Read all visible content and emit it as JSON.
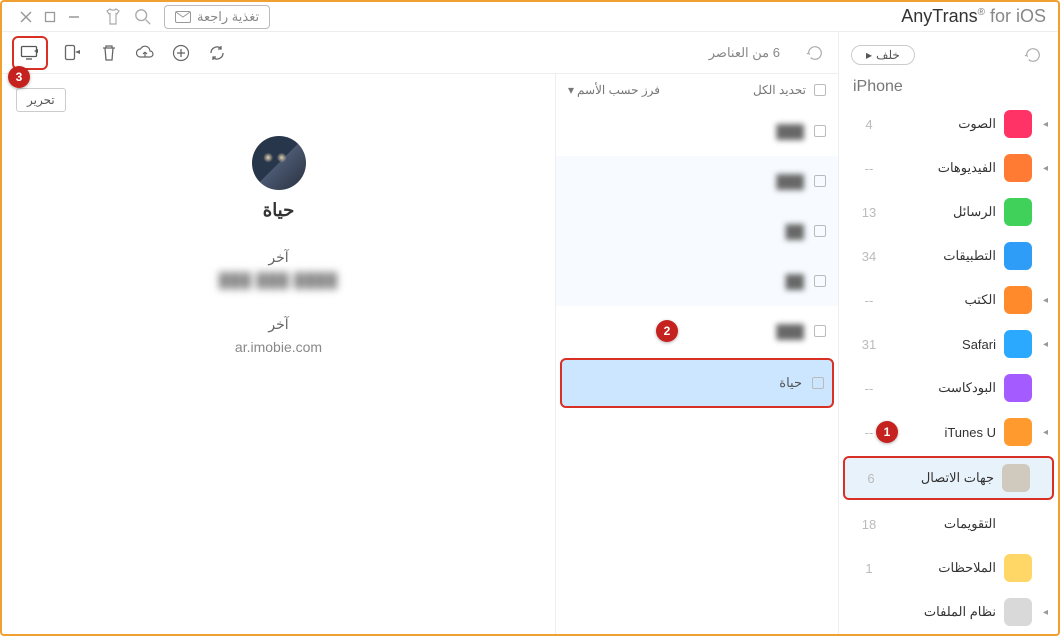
{
  "brand": {
    "name": "AnyTrans",
    "suffix": "for iOS"
  },
  "titlebar": {
    "feedback": "تغذية راجعة"
  },
  "toolbar": {
    "items_count": "6 من العناصر",
    "sort_label": "فرز حسب الأسم",
    "select_all": "تحديد الكل"
  },
  "sidebar": {
    "back": "خلف",
    "device": "iPhone",
    "items": [
      {
        "label": "الصوت",
        "count": "4",
        "color": "#ff3366",
        "arrow": true
      },
      {
        "label": "الفيديوهات",
        "count": "--",
        "color": "#ff7b33",
        "arrow": true
      },
      {
        "label": "الرسائل",
        "count": "13",
        "color": "#3fd15a",
        "arrow": false
      },
      {
        "label": "التطبيقات",
        "count": "34",
        "color": "#2e9df7",
        "arrow": false
      },
      {
        "label": "الكتب",
        "count": "--",
        "color": "#ff8a2b",
        "arrow": true
      },
      {
        "label": "Safari",
        "count": "31",
        "color": "#2aa9ff",
        "arrow": true
      },
      {
        "label": "البودكاست",
        "count": "--",
        "color": "#a45bff",
        "arrow": false
      },
      {
        "label": "iTunes U",
        "count": "--",
        "color": "#ff9a2e",
        "arrow": true
      },
      {
        "label": "جهات الاتصال",
        "count": "6",
        "color": "#d0c9bd",
        "arrow": false,
        "selected": true
      },
      {
        "label": "التقويمات",
        "count": "18",
        "color": "#ffffff",
        "arrow": false
      },
      {
        "label": "الملاحظات",
        "count": "1",
        "color": "#ffd766",
        "arrow": false
      },
      {
        "label": "نظام الملفات",
        "count": "",
        "color": "#d9d9d9",
        "arrow": true
      }
    ]
  },
  "contacts": [
    {
      "name": "███",
      "selected": false
    },
    {
      "name": "███",
      "selected": false
    },
    {
      "name": "██",
      "selected": false
    },
    {
      "name": "██",
      "selected": false
    },
    {
      "name": "███",
      "selected": false
    },
    {
      "name": "حياة",
      "selected": true,
      "clear": true
    }
  ],
  "detail": {
    "edit": "تحرير",
    "name": "حياة",
    "field1_label": "آخر",
    "field1_value": "███ ███ ████",
    "field2_label": "آخر",
    "field2_value": "ar.imobie.com"
  },
  "callouts": {
    "c1": "1",
    "c2": "2",
    "c3": "3"
  }
}
